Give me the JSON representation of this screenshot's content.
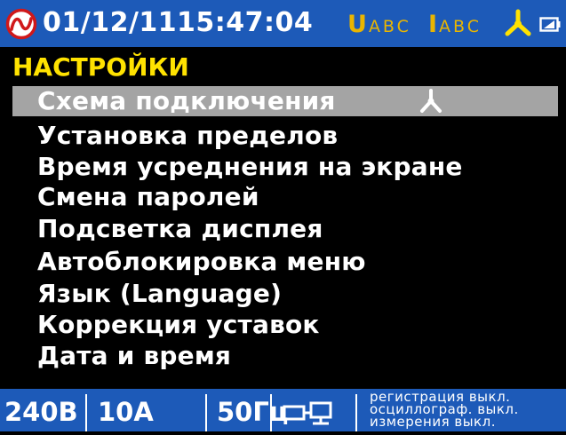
{
  "header": {
    "date": "01/12/11",
    "time": "15:47:04",
    "voltage_indicator": {
      "letter": "U",
      "phases": "ABC"
    },
    "current_indicator": {
      "letter": "I",
      "phases": "ABC"
    },
    "logo_icon": "logo-icon",
    "connection_icon": "star-connection-icon",
    "battery_icon": "battery-icon",
    "indicator_color": "#e9b500",
    "bar_color": "#1d5ab8"
  },
  "menu": {
    "title": "НАСТРОЙКИ",
    "title_color": "#ffe200",
    "selected_index": 0,
    "selected_bg": "#a4a4a4",
    "items": [
      {
        "label": "Схема подключения"
      },
      {
        "label": "Установка пределов"
      },
      {
        "label": "Время усреднения на экране"
      },
      {
        "label": "Смена паролей"
      },
      {
        "label": "Подсветка дисплея"
      },
      {
        "label": "Автоблокировка меню"
      },
      {
        "label": "Язык (Language)"
      },
      {
        "label": "Коррекция уставок"
      },
      {
        "label": "Дата и время"
      }
    ]
  },
  "footer": {
    "voltage": "240В",
    "current": "10А",
    "frequency": "50Гц",
    "network_icon": "network-icon",
    "status_lines": [
      "регистрация выкл.",
      "осциллограф. выкл.",
      "измерения выкл."
    ]
  }
}
